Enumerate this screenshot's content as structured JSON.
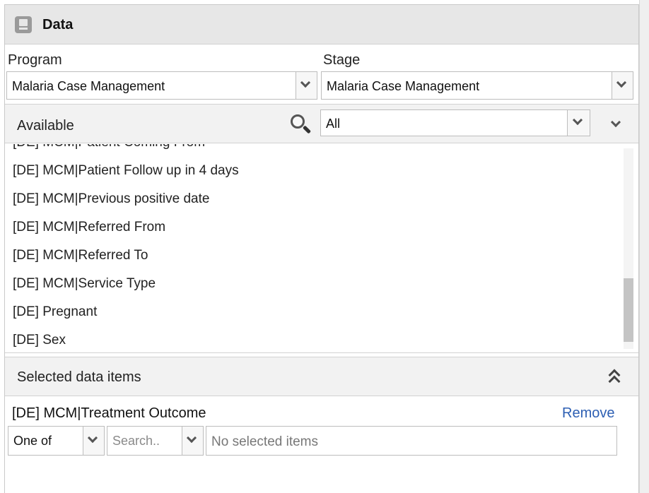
{
  "header": {
    "title": "Data",
    "icon": "data-icon"
  },
  "program": {
    "label": "Program",
    "value": "Malaria Case Management"
  },
  "stage": {
    "label": "Stage",
    "value": "Malaria Case Management"
  },
  "available": {
    "label": "Available",
    "filter_value": "All",
    "items": [
      "[DE] MCM|Patient Coming From",
      "[DE] MCM|Patient Follow up in 4 days",
      "[DE] MCM|Previous positive date",
      "[DE] MCM|Referred From",
      "[DE] MCM|Referred To",
      "[DE] MCM|Service Type",
      "[DE] Pregnant",
      "[DE] Sex"
    ]
  },
  "selected": {
    "label": "Selected data items",
    "item": {
      "name": "[DE] MCM|Treatment Outcome",
      "remove_label": "Remove",
      "operator": "One of",
      "search_placeholder": "Search..",
      "items_placeholder": "No selected items"
    }
  },
  "colors": {
    "link": "#2d5fb3",
    "header_bg": "#e7e7e7",
    "bar_bg": "#f2f2f2"
  }
}
